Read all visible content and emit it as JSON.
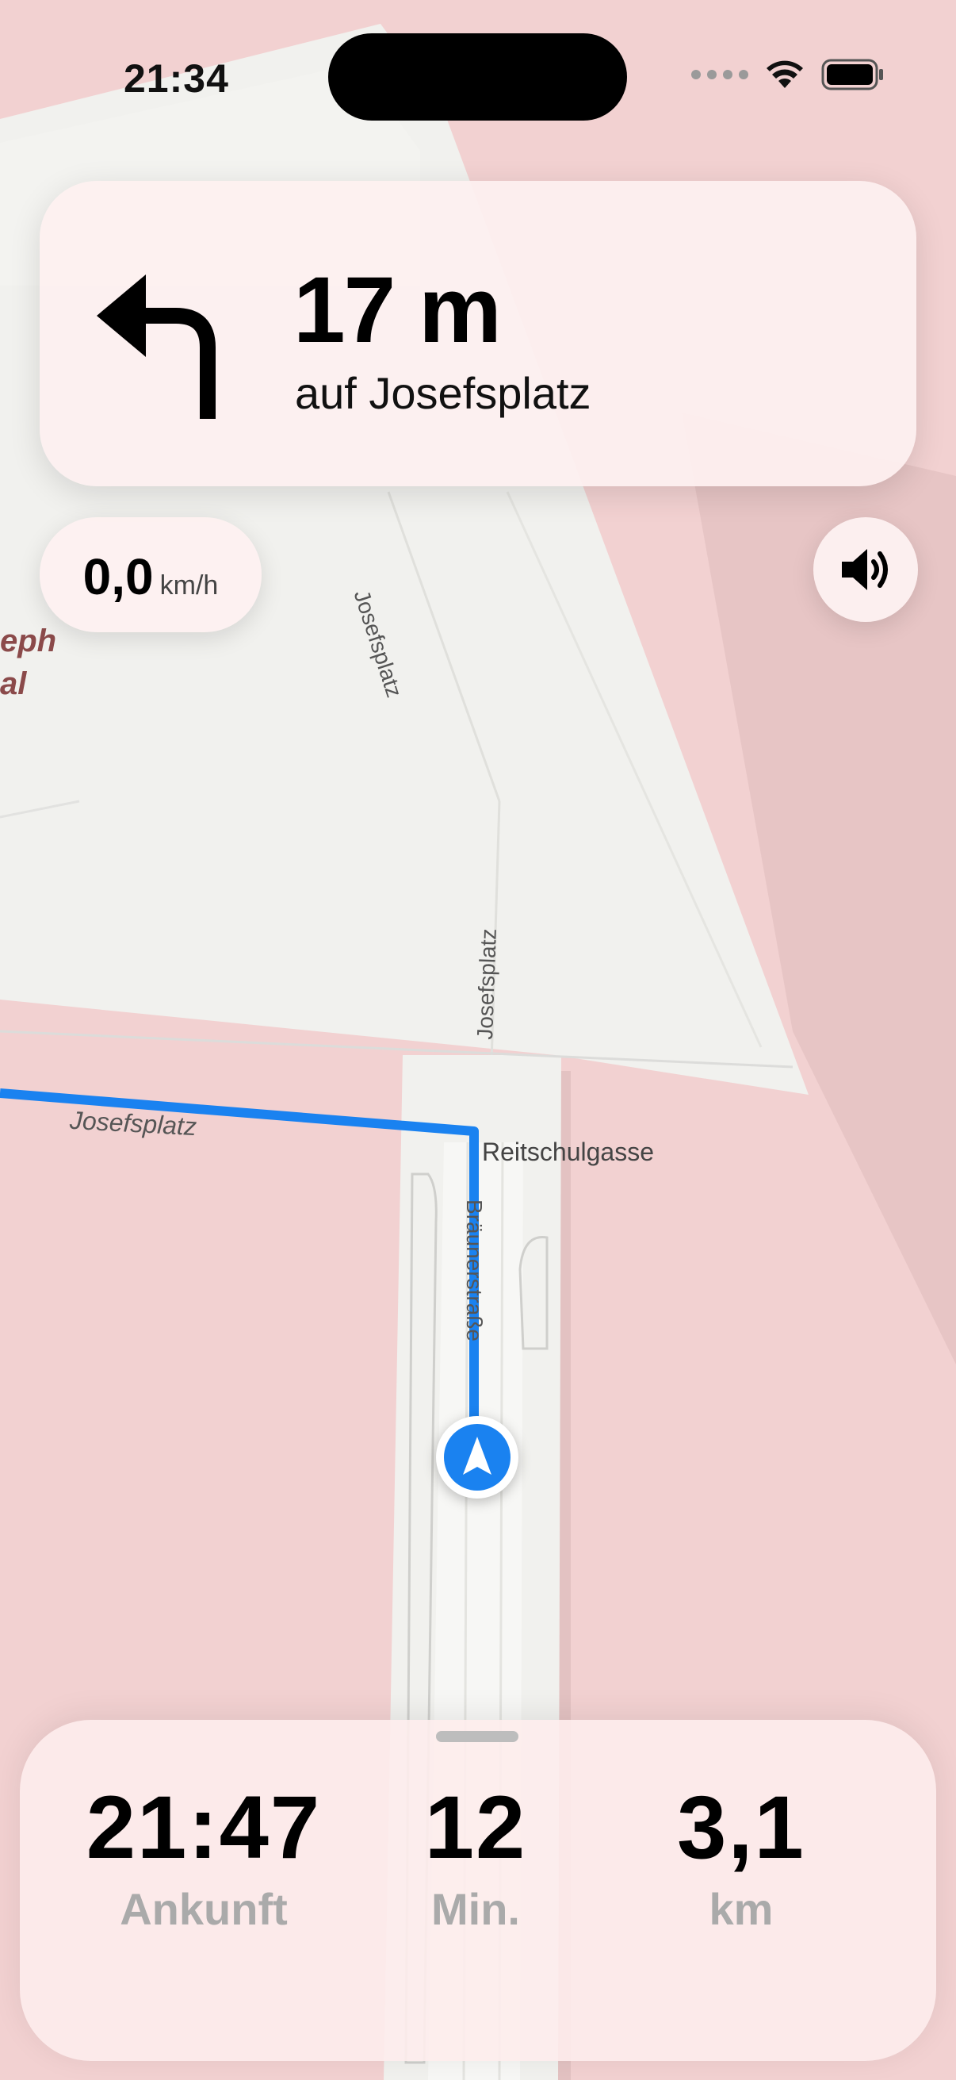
{
  "status_bar": {
    "time": "21:34"
  },
  "maneuver": {
    "distance": "17 m",
    "street": "auf Josefsplatz",
    "icon": "turn-left-arrow-icon"
  },
  "speed": {
    "value": "0,0",
    "unit": "km/h"
  },
  "volume": {
    "icon": "speaker-icon"
  },
  "map": {
    "labels": {
      "josefsplatz_1": "Josefsplatz",
      "josefsplatz_2": "Josefsplatz",
      "josefsplatz_3": "Josefsplatz",
      "reitschulgasse": "Reitschulgasse",
      "braeunerstrasse": "Bräunerstraße",
      "poi_line1": "eph",
      "poi_line2": "al"
    },
    "colors": {
      "route": "#1a82f0",
      "buildings": "#f2d1d1",
      "street": "#f1f1ee"
    }
  },
  "trip": {
    "arrival": {
      "value": "21:47",
      "label": "Ankunft"
    },
    "minutes": {
      "value": "12",
      "label": "Min."
    },
    "distance": {
      "value": "3,1",
      "label": "km"
    }
  }
}
